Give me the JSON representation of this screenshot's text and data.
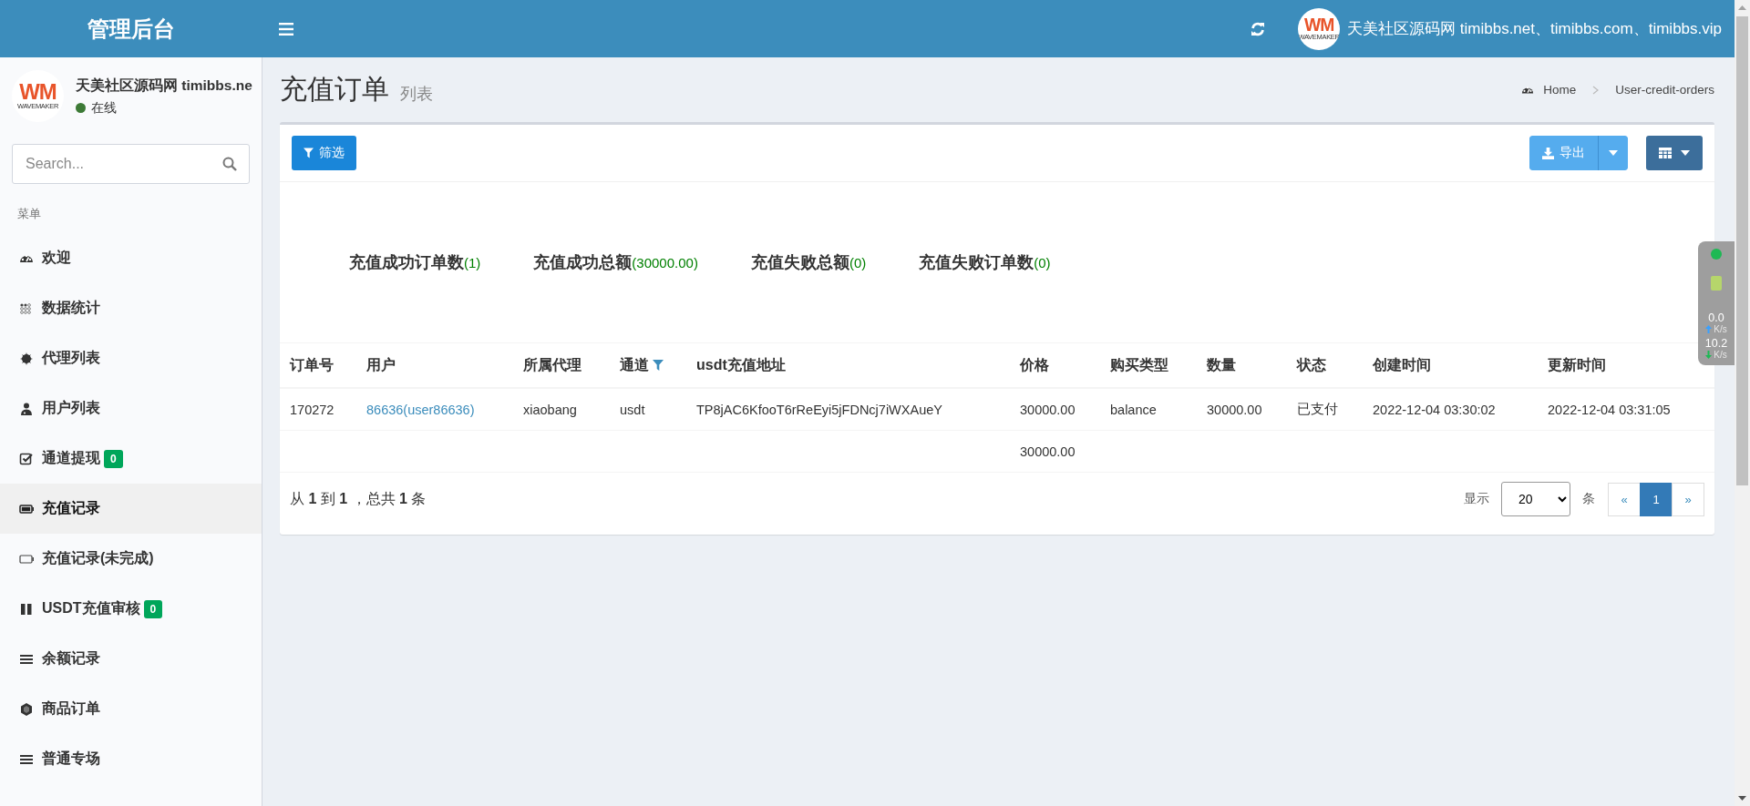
{
  "header": {
    "brand": "管理后台",
    "user": {
      "logo": {
        "mark": "WM",
        "caption": "WAVEMAKER"
      },
      "name": "天美社区源码网 timibbs.net、timibbs.com、timibbs.vip"
    }
  },
  "sidebar": {
    "user": {
      "logo": {
        "mark": "WM",
        "caption": "WAVEMAKER"
      },
      "name": "天美社区源码网 timibbs.ne",
      "status": "在线"
    },
    "search": {
      "placeholder": "Search..."
    },
    "section": "菜单",
    "items": [
      {
        "label": "欢迎",
        "selected": false
      },
      {
        "label": "数据统计",
        "selected": false
      },
      {
        "label": "代理列表",
        "selected": false
      },
      {
        "label": "用户列表",
        "selected": false
      },
      {
        "label": "通道提现",
        "selected": false,
        "badge": "0"
      },
      {
        "label": "充值记录",
        "selected": true
      },
      {
        "label": "充值记录(未完成)",
        "selected": false
      },
      {
        "label": "USDT充值审核",
        "selected": false,
        "badge": "0"
      },
      {
        "label": "余额记录",
        "selected": false
      },
      {
        "label": "商品订单",
        "selected": false
      },
      {
        "label": "普通专场",
        "selected": false
      }
    ]
  },
  "page": {
    "title": "充值订单",
    "subtitle": "列表",
    "breadcrumb": [
      "Home",
      "User-credit-orders"
    ]
  },
  "toolbar": {
    "filter": "筛选",
    "export": "导出"
  },
  "stats": [
    {
      "label": "充值成功订单数",
      "value": "(1)"
    },
    {
      "label": "充值成功总额",
      "value": "(30000.00)"
    },
    {
      "label": "充值失败总额",
      "value": "(0)"
    },
    {
      "label": "充值失败订单数",
      "value": "(0)"
    }
  ],
  "table": {
    "columns": [
      {
        "label": "订单号"
      },
      {
        "label": "用户"
      },
      {
        "label": "所属代理"
      },
      {
        "label": "通道",
        "filter": true
      },
      {
        "label": "usdt充值地址"
      },
      {
        "label": "价格",
        "total": "30000.00"
      },
      {
        "label": "购买类型"
      },
      {
        "label": "数量"
      },
      {
        "label": "状态"
      },
      {
        "label": "创建时间"
      },
      {
        "label": "更新时间"
      }
    ],
    "rows": [
      [
        "170272",
        "86636(user86636)",
        "xiaobang",
        "usdt",
        "TP8jAC6KfooT6rReEyi5jFDNcj7iWXAueY",
        "30000.00",
        "balance",
        "30000.00",
        "已支付",
        "2022-12-04 03:30:02",
        "2022-12-04 03:31:05"
      ]
    ]
  },
  "footer": {
    "summary": "从 **1** 到 **1** ，总共 **1** 条",
    "show": "显示",
    "page_size": "20",
    "unit": "条",
    "pages": [
      {
        "label": "«",
        "selected": false
      },
      {
        "label": "1",
        "selected": true
      },
      {
        "label": "»",
        "selected": false
      }
    ]
  },
  "net_widget": {
    "upload": "0.0",
    "upload_unit": "K/s",
    "download": "10.2",
    "download_unit": "K/s"
  }
}
